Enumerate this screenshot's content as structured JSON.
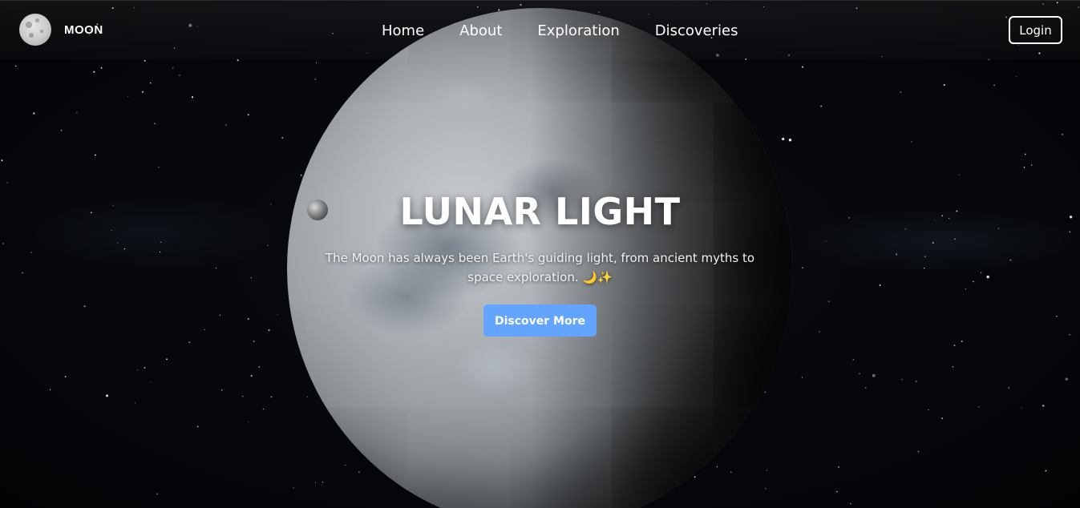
{
  "header": {
    "brand": "MOON",
    "nav": [
      "Home",
      "About",
      "Exploration",
      "Discoveries"
    ],
    "login_label": "Login"
  },
  "hero": {
    "title": "LUNAR LIGHT",
    "text": "The Moon has always been Earth's guiding light, from ancient myths to space exploration. 🌙✨",
    "cta_label": "Discover More"
  },
  "colors": {
    "accent": "#62a4ff",
    "background": "#05070b",
    "text": "#ffffff"
  },
  "icons": [
    "moon-logo-icon"
  ]
}
